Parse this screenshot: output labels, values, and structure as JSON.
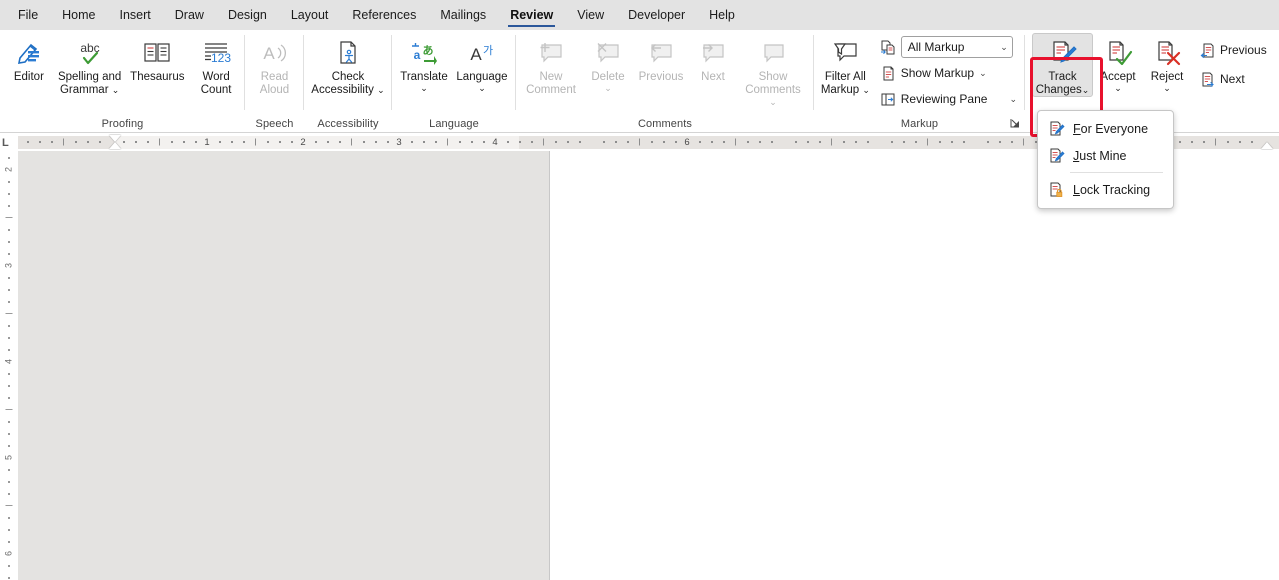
{
  "app": {
    "title": "Microsoft Word - Review Ribbon",
    "accent_color": "#2b579a",
    "highlight_color": "#e8112d"
  },
  "tabs": [
    {
      "label": "File",
      "active": false
    },
    {
      "label": "Home",
      "active": false
    },
    {
      "label": "Insert",
      "active": false
    },
    {
      "label": "Draw",
      "active": false
    },
    {
      "label": "Design",
      "active": false
    },
    {
      "label": "Layout",
      "active": false
    },
    {
      "label": "References",
      "active": false
    },
    {
      "label": "Mailings",
      "active": false
    },
    {
      "label": "Review",
      "active": true
    },
    {
      "label": "View",
      "active": false
    },
    {
      "label": "Developer",
      "active": false
    },
    {
      "label": "Help",
      "active": false
    }
  ],
  "ribbon": {
    "groups": [
      {
        "name": "proofing",
        "label": "Proofing",
        "buttons": [
          {
            "name": "editor",
            "label_line1": "Editor",
            "label_line2": "",
            "icon": "editor-pen-icon",
            "disabled": false,
            "has_caret": false
          },
          {
            "name": "spelling-and-grammar",
            "label_line1": "Spelling and",
            "label_line2": "Grammar",
            "icon": "abc-check-icon",
            "disabled": false,
            "has_caret": true
          },
          {
            "name": "thesaurus",
            "label_line1": "Thesaurus",
            "label_line2": "",
            "icon": "open-book-icon",
            "disabled": false,
            "has_caret": false
          },
          {
            "name": "word-count",
            "label_line1": "Word",
            "label_line2": "Count",
            "icon": "word-count-123-icon",
            "disabled": false,
            "has_caret": false
          }
        ]
      },
      {
        "name": "speech",
        "label": "Speech",
        "buttons": [
          {
            "name": "read-aloud",
            "label_line1": "Read",
            "label_line2": "Aloud",
            "icon": "speaker-a-icon",
            "disabled": true,
            "has_caret": false
          }
        ]
      },
      {
        "name": "accessibility",
        "label": "Accessibility",
        "buttons": [
          {
            "name": "check-accessibility",
            "label_line1": "Check",
            "label_line2": "Accessibility",
            "icon": "accessibility-page-icon",
            "disabled": false,
            "has_caret": true
          }
        ]
      },
      {
        "name": "language",
        "label": "Language",
        "buttons": [
          {
            "name": "translate",
            "label_line1": "Translate",
            "label_line2": "",
            "icon": "translate-icon",
            "disabled": false,
            "has_caret": true
          },
          {
            "name": "language",
            "label_line1": "Language",
            "label_line2": "",
            "icon": "language-a-icon",
            "disabled": false,
            "has_caret": true
          }
        ]
      },
      {
        "name": "comments",
        "label": "Comments",
        "buttons": [
          {
            "name": "new-comment",
            "label_line1": "New",
            "label_line2": "Comment",
            "icon": "comment-plus-icon",
            "disabled": true,
            "has_caret": false
          },
          {
            "name": "delete-comment",
            "label_line1": "Delete",
            "label_line2": "",
            "icon": "comment-x-icon",
            "disabled": true,
            "has_caret": true
          },
          {
            "name": "previous-comment",
            "label_line1": "Previous",
            "label_line2": "",
            "icon": "comment-left-arrow-icon",
            "disabled": true,
            "has_caret": false
          },
          {
            "name": "next-comment",
            "label_line1": "Next",
            "label_line2": "",
            "icon": "comment-right-arrow-icon",
            "disabled": true,
            "has_caret": false
          },
          {
            "name": "show-comments",
            "label_line1": "Show",
            "label_line2": "Comments",
            "icon": "comment-icon",
            "disabled": true,
            "has_caret": true
          }
        ]
      },
      {
        "name": "markup",
        "label": "Markup",
        "buttons": [
          {
            "name": "filter-all-markup",
            "label_line1": "Filter All",
            "label_line2": "Markup",
            "icon": "filter-comment-icon",
            "disabled": false,
            "has_caret": true
          }
        ]
      },
      {
        "name": "changes",
        "label": "",
        "buttons": []
      }
    ],
    "markup": {
      "display_combo_value": "All Markup",
      "display_combo_icon": "markup-display-icon",
      "show_markup_label": "Show Markup",
      "show_markup_icon": "show-markup-page-icon",
      "reviewing_pane_label": "Reviewing Pane",
      "reviewing_pane_icon": "reviewing-pane-icon",
      "dialog_launcher": "dialog-launcher-icon"
    },
    "tracking": {
      "track_changes": {
        "label_line1": "Track",
        "label_line2": "Changes",
        "icon": "track-changes-pen-icon",
        "pressed": true,
        "highlighted": true
      },
      "accept": {
        "label": "Accept",
        "icon": "accept-check-icon"
      },
      "reject": {
        "label": "Reject",
        "icon": "reject-x-icon"
      },
      "previous": {
        "label": "Previous",
        "icon": "previous-change-icon"
      },
      "next": {
        "label": "Next",
        "icon": "next-change-icon"
      }
    }
  },
  "dropdown": {
    "open": true,
    "items": [
      {
        "name": "for-everyone",
        "accel": "F",
        "rest": "or Everyone",
        "icon": "track-changes-everyone-icon",
        "separator_after": false
      },
      {
        "name": "just-mine",
        "accel": "J",
        "rest": "ust Mine",
        "icon": "track-changes-mine-icon",
        "separator_after": true
      },
      {
        "name": "lock-tracking",
        "accel": "L",
        "rest": "ock Tracking",
        "icon": "lock-tracking-icon",
        "separator_after": false
      }
    ]
  },
  "rulers": {
    "tab_selector": "L",
    "horizontal_numbers": [
      "1",
      "2",
      "3",
      "4",
      "6"
    ],
    "vertical_numbers": [
      "2",
      "3",
      "4",
      "5",
      "6"
    ],
    "units": "inches"
  },
  "document": {
    "page_background": "#e4e3e1",
    "canvas_background": "#ffffff",
    "content": ""
  }
}
